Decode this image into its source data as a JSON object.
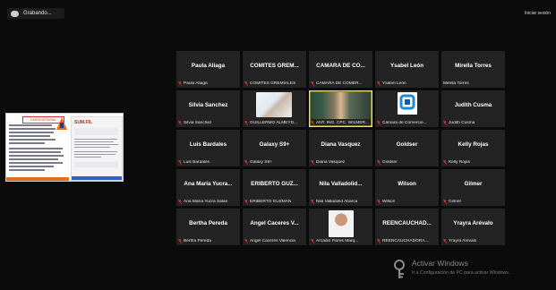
{
  "recording": {
    "label": "Grabando...",
    "icon": "cloud-record-icon"
  },
  "login_link": "Iniciar sesión",
  "participants": [
    {
      "name": "Paula Aliaga",
      "subtitle": "Paula Aliaga",
      "muted": true
    },
    {
      "name": "COMITES GREM...",
      "subtitle": "COMITES GREMIALES",
      "muted": true
    },
    {
      "name": "CAMARA DE CO...",
      "subtitle": "CAMARA DE COMER...",
      "muted": true
    },
    {
      "name": "Ysabel León",
      "subtitle": "Ysabel León",
      "muted": true
    },
    {
      "name": "Mirella Torres",
      "subtitle": "Mirella Torres",
      "muted": false
    },
    {
      "name": "Silvia Sanchez",
      "subtitle": "Silvia Sanchez",
      "muted": true
    },
    {
      "name": "",
      "subtitle": "GUILLERMO ALMEYD...",
      "muted": true,
      "avatar": "handshake-photo"
    },
    {
      "name": "",
      "subtitle": "ANT. ING. CPC. WILMER...",
      "muted": true,
      "avatar": "video-feed",
      "active": true
    },
    {
      "name": "",
      "subtitle": "Cámara de Comercio...",
      "muted": true,
      "avatar": "chamber-logo"
    },
    {
      "name": "Judith Cusma",
      "subtitle": "Judith Cusma",
      "muted": true
    },
    {
      "name": "Luis Bardales",
      "subtitle": "Luis Bardales",
      "muted": true
    },
    {
      "name": "Galaxy S9+",
      "subtitle": "Galaxy S9+",
      "muted": true
    },
    {
      "name": "Diana Vasquez",
      "subtitle": "Diana Vasquez",
      "muted": true
    },
    {
      "name": "Goldser",
      "subtitle": "Goldser",
      "muted": true
    },
    {
      "name": "Kelly Rojas",
      "subtitle": "Kelly Rojas",
      "muted": true
    },
    {
      "name": "Ana María Yucra...",
      "subtitle": "Ana María Yucra Salas",
      "muted": true
    },
    {
      "name": "ERIBERTO GUZ...",
      "subtitle": "ERIBERTO GUZMAN",
      "muted": true
    },
    {
      "name": "Nila Valladolid...",
      "subtitle": "Nila Valladolid Abarca",
      "muted": true
    },
    {
      "name": "Wilson",
      "subtitle": "Wilson",
      "muted": true
    },
    {
      "name": "Gilmer",
      "subtitle": "Gilmer",
      "muted": true
    },
    {
      "name": "Bertha Pereda",
      "subtitle": "Bertha Pereda",
      "muted": true
    },
    {
      "name": "Angel Caceres V...",
      "subtitle": "Angel Caceres Valencia",
      "muted": true
    },
    {
      "name": "",
      "subtitle": "Arcadio Flores Marq...",
      "muted": true,
      "avatar": "person-photo"
    },
    {
      "name": "REENCAUCHAD...",
      "subtitle": "REENCAUCHADORA ...",
      "muted": true
    },
    {
      "name": "Yrayra Arévalo",
      "subtitle": "Yrayra Arévalo",
      "muted": true
    }
  ],
  "shared_screen": {
    "header": "CARTA NOTARIAL",
    "brand": "SUM.FIL"
  },
  "watermark": {
    "title": "Activar Windows",
    "subtitle": "Ir a Configuración de PC para activar Windows."
  },
  "colors": {
    "tile_bg": "#232323",
    "mic_red": "#e0332d",
    "active_border": "#e8e840"
  }
}
